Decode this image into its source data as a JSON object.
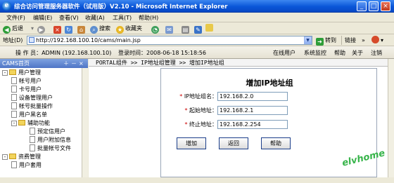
{
  "window": {
    "title": "综合访问管理服务器软件（试用版）V2.10 - Microsoft Internet Explorer",
    "min": "_",
    "max": "□",
    "close": "×"
  },
  "menu": {
    "items": [
      "文件(F)",
      "编辑(E)",
      "查看(V)",
      "收藏(A)",
      "工具(T)",
      "帮助(H)"
    ]
  },
  "toolbar": {
    "back": "后退",
    "search": "搜索",
    "favorites": "收藏夹",
    "go": "转到",
    "links": "链接"
  },
  "address": {
    "label": "地址(D)",
    "url": "http://192.168.100.10/cams/main.jsp"
  },
  "infobar": {
    "operator": "操 作 员：ADMIN (192.168.100.10)",
    "login_time": "登录时间：2008-06-18 15:18:56",
    "links": [
      "在线用户",
      "系统监控",
      "帮助",
      "关于",
      "注销"
    ]
  },
  "sidebar": {
    "header": "CAMS首页",
    "tree": [
      {
        "label": "用户管理",
        "level": 0,
        "type": "folder",
        "toggle": "-"
      },
      {
        "label": "帐号用户",
        "level": 1,
        "type": "page"
      },
      {
        "label": "卡号用户",
        "level": 1,
        "type": "page"
      },
      {
        "label": "设备管理用户",
        "level": 1,
        "type": "page"
      },
      {
        "label": "帐号批量操作",
        "level": 1,
        "type": "page"
      },
      {
        "label": "用户黑名单",
        "level": 1,
        "type": "page"
      },
      {
        "label": "辅助功能",
        "level": 1,
        "type": "folder",
        "toggle": "-"
      },
      {
        "label": "预定信用户",
        "level": 2,
        "type": "page"
      },
      {
        "label": "用户附加信息",
        "level": 2,
        "type": "page"
      },
      {
        "label": "批量帐号文件",
        "level": 2,
        "type": "page"
      },
      {
        "label": "资费管理",
        "level": 0,
        "type": "folder",
        "toggle": "-"
      },
      {
        "label": "用户套用",
        "level": 1,
        "type": "page"
      }
    ]
  },
  "breadcrumb": "PORTAL组件 >> IP地址组管理 >> 增加IP地址组",
  "form": {
    "title": "增加IP地址组",
    "fields": [
      {
        "label": "IP地址组名：",
        "value": "192.168.2.0"
      },
      {
        "label": "起始地址：",
        "value": "192.168.2.1"
      },
      {
        "label": "终止地址：",
        "value": "192.168.2.254"
      }
    ],
    "buttons": {
      "add": "增加",
      "back": "返回",
      "help": "帮助"
    }
  },
  "watermark": "elvhome"
}
